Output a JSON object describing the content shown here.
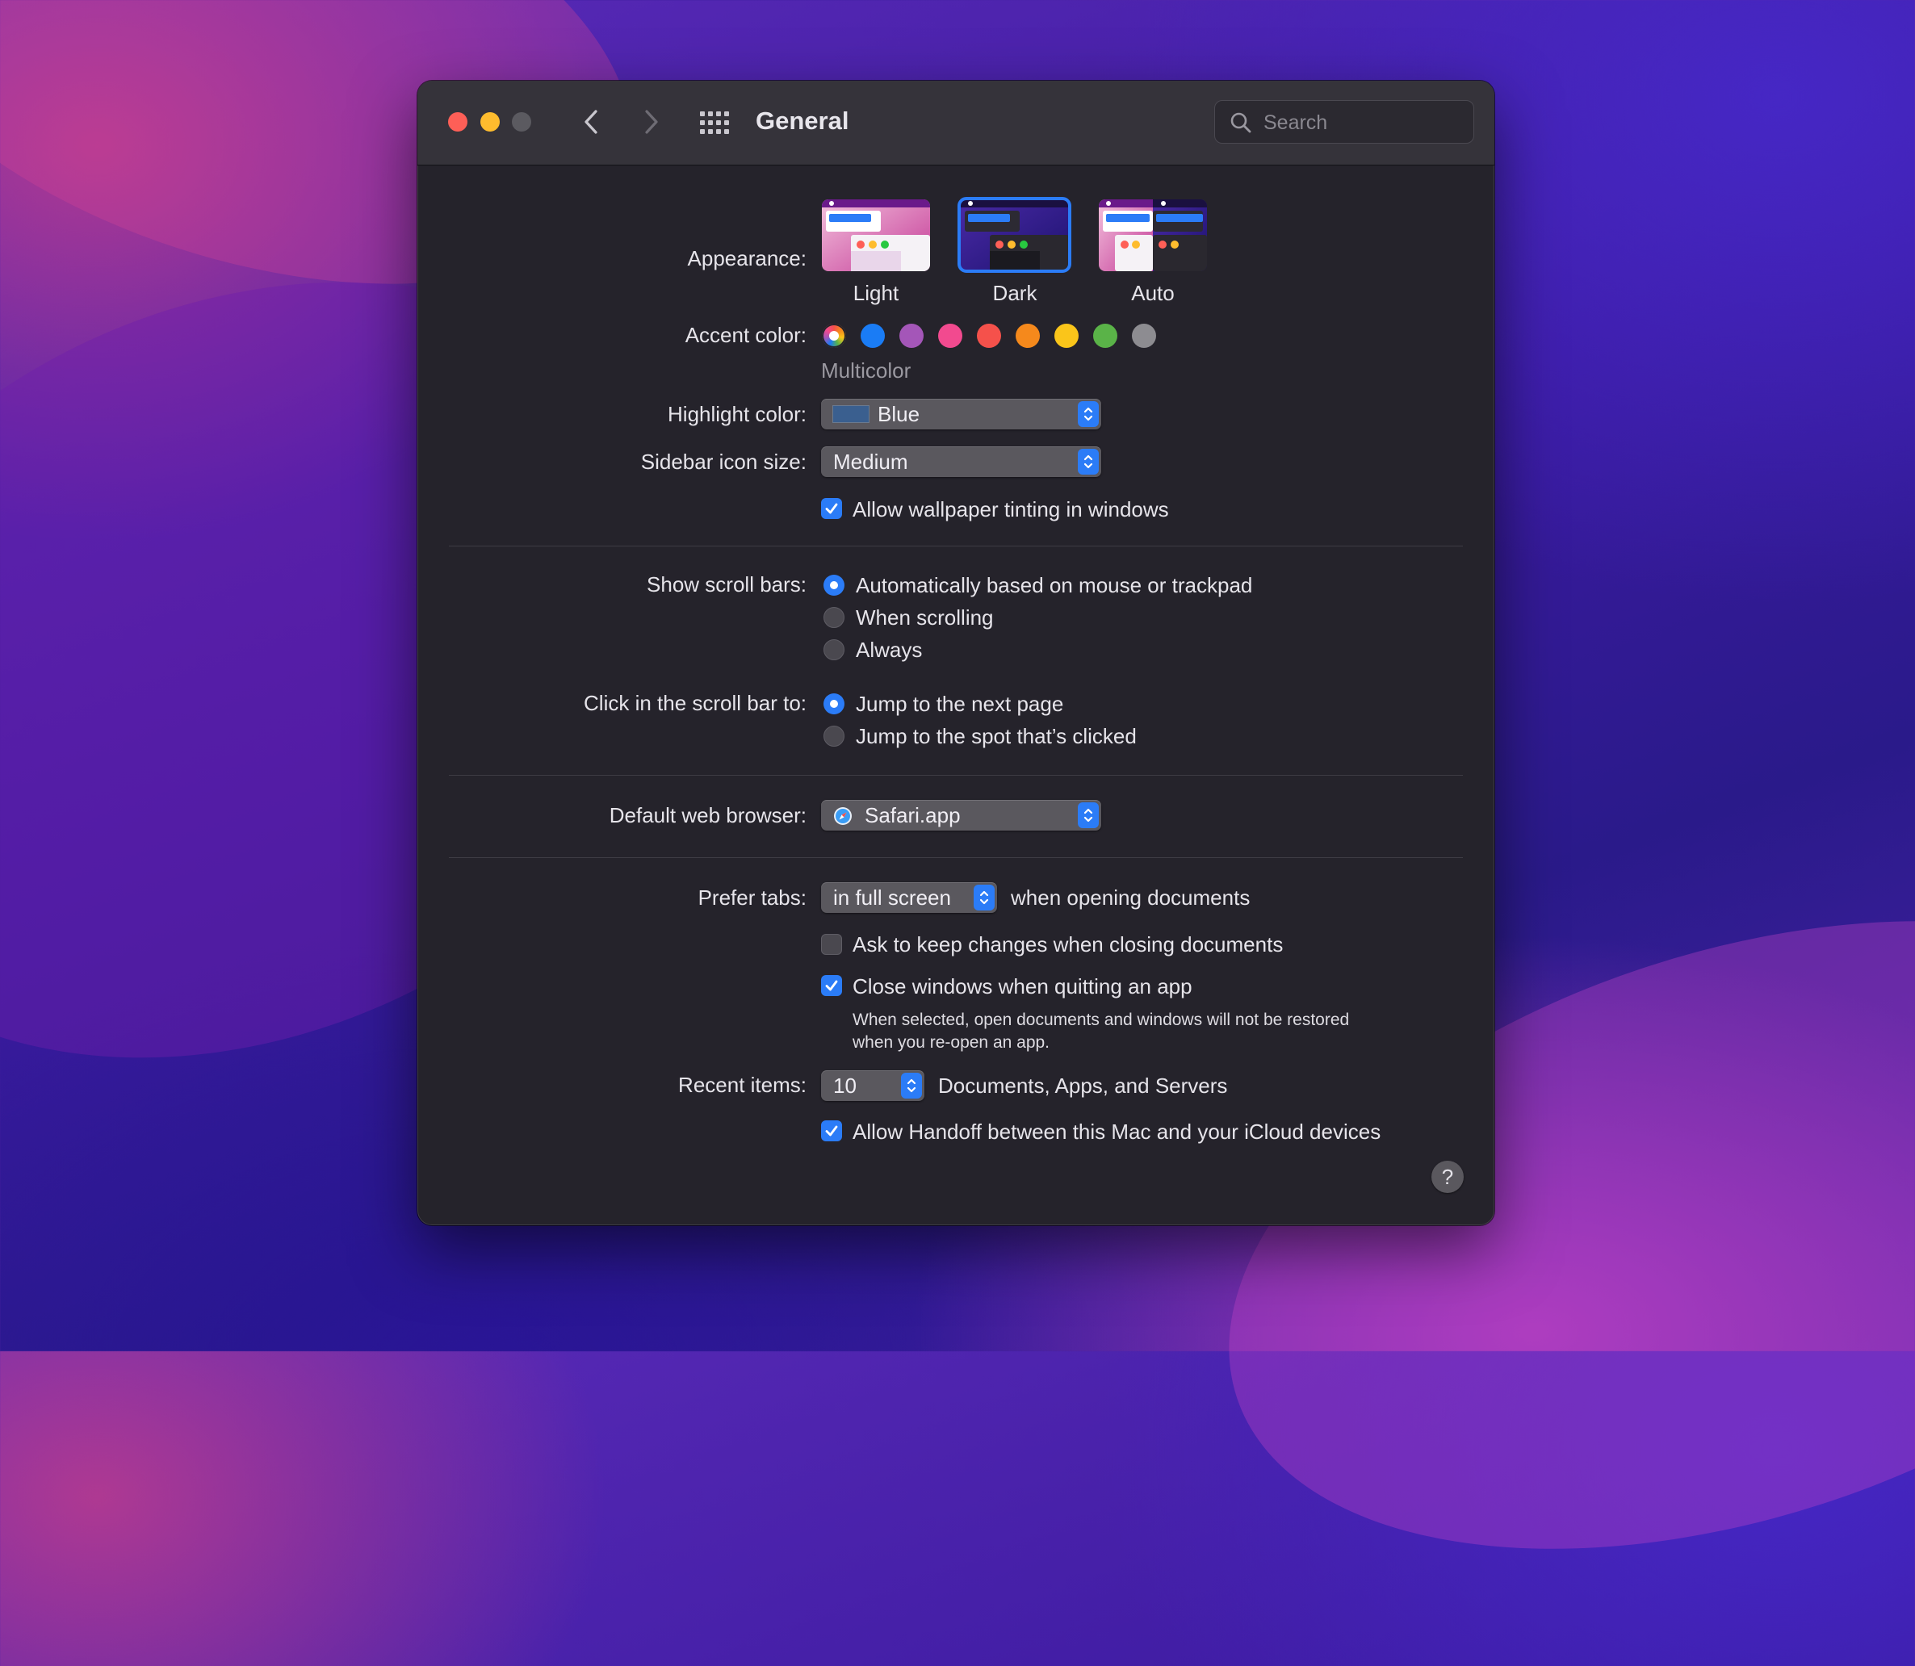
{
  "window": {
    "title": "General"
  },
  "search": {
    "placeholder": "Search"
  },
  "appearance": {
    "label": "Appearance:",
    "options": [
      {
        "label": "Light",
        "selected": false
      },
      {
        "label": "Dark",
        "selected": true
      },
      {
        "label": "Auto",
        "selected": false
      }
    ]
  },
  "accent": {
    "label": "Accent color:",
    "selected_name": "Multicolor",
    "colors": [
      "multicolor",
      "#1a7cf5",
      "#a456b8",
      "#f24a8f",
      "#f5514b",
      "#f5891c",
      "#fac51a",
      "#5ab348",
      "#8d8c91"
    ]
  },
  "highlight": {
    "label": "Highlight color:",
    "value": "Blue",
    "swatch": "#3a5f8f"
  },
  "sidebar_icon_size": {
    "label": "Sidebar icon size:",
    "value": "Medium"
  },
  "wallpaper_tinting": {
    "label": "Allow wallpaper tinting in windows",
    "checked": true
  },
  "scroll_bars": {
    "label": "Show scroll bars:",
    "options": [
      {
        "label": "Automatically based on mouse or trackpad",
        "selected": true
      },
      {
        "label": "When scrolling",
        "selected": false
      },
      {
        "label": "Always",
        "selected": false
      }
    ]
  },
  "click_scroll": {
    "label": "Click in the scroll bar to:",
    "options": [
      {
        "label": "Jump to the next page",
        "selected": true
      },
      {
        "label": "Jump to the spot that’s clicked",
        "selected": false
      }
    ]
  },
  "browser": {
    "label": "Default web browser:",
    "value": "Safari.app"
  },
  "prefer_tabs": {
    "label": "Prefer tabs:",
    "value": "in full screen",
    "suffix": "when opening documents"
  },
  "ask_keep_changes": {
    "label": "Ask to keep changes when closing documents",
    "checked": false
  },
  "close_windows": {
    "label": "Close windows when quitting an app",
    "checked": true,
    "note_line1": "When selected, open documents and windows will not be restored",
    "note_line2": "when you re-open an app."
  },
  "recent_items": {
    "label": "Recent items:",
    "value": "10",
    "suffix": "Documents, Apps, and Servers"
  },
  "handoff": {
    "label": "Allow Handoff between this Mac and your iCloud devices",
    "checked": true
  },
  "help": {
    "label": "?"
  },
  "colors": {
    "accent": "#2b7cf7",
    "window_bg": "#25232b",
    "titlebar_bg": "#35333a"
  }
}
